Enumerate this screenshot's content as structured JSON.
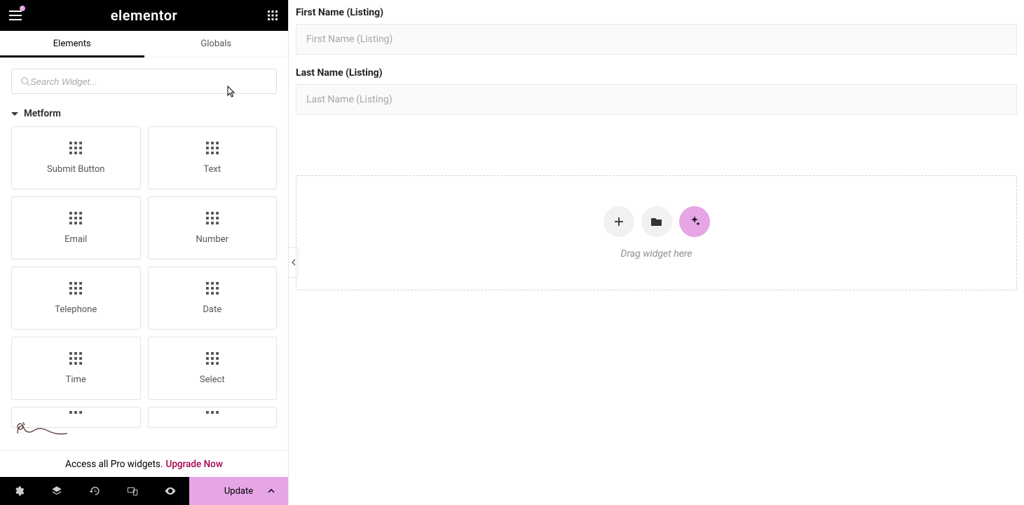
{
  "header": {
    "logo": "elementor"
  },
  "tabs": {
    "elements": "Elements",
    "globals": "Globals",
    "active": "elements"
  },
  "search": {
    "placeholder": "Search Widget..."
  },
  "category": {
    "name": "Metform"
  },
  "widgets": [
    {
      "label": "Submit Button"
    },
    {
      "label": "Text"
    },
    {
      "label": "Email"
    },
    {
      "label": "Number"
    },
    {
      "label": "Telephone"
    },
    {
      "label": "Date"
    },
    {
      "label": "Time"
    },
    {
      "label": "Select"
    }
  ],
  "promo": {
    "text": "Access all Pro widgets.",
    "link": "Upgrade Now"
  },
  "update_button": {
    "label": "Update"
  },
  "canvas": {
    "fields": [
      {
        "label": "First Name (Listing)",
        "placeholder": "First Name (Listing)"
      },
      {
        "label": "Last Name (Listing)",
        "placeholder": "Last Name (Listing)"
      }
    ],
    "drop_text": "Drag widget here"
  },
  "colors": {
    "accent": "#e6a6e6",
    "upgrade": "#a4034b"
  }
}
